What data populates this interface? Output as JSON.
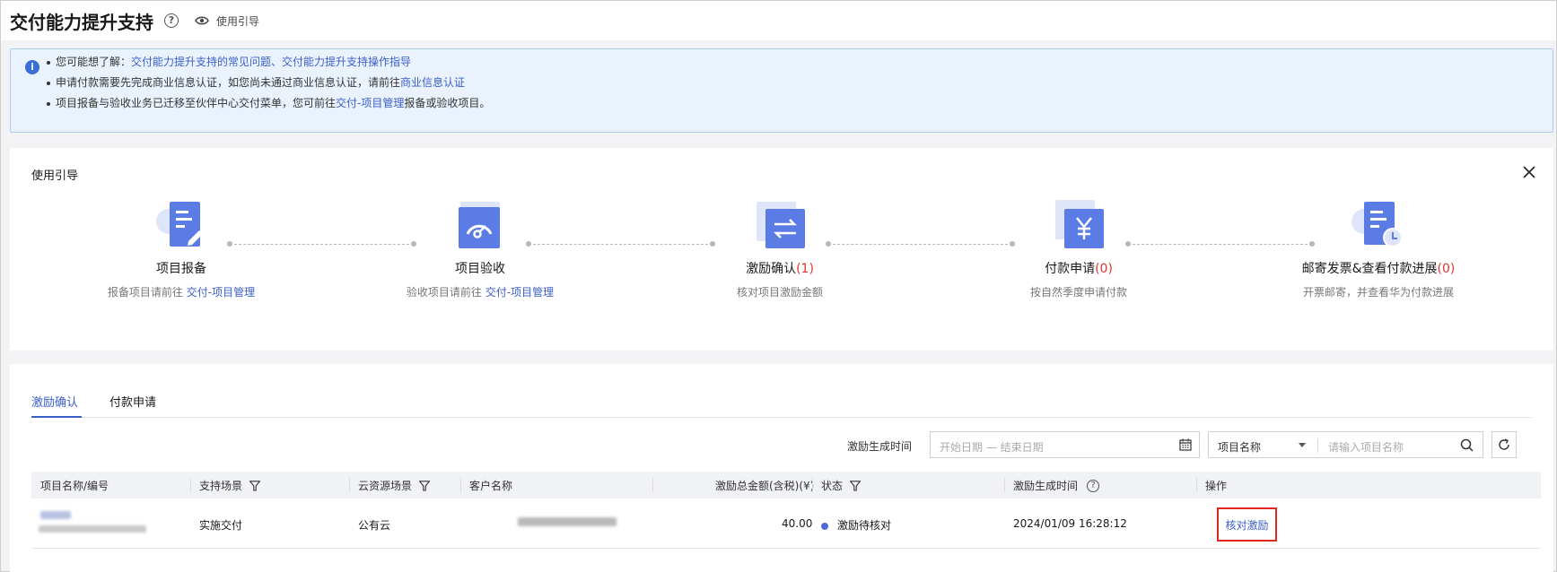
{
  "colors": {
    "accent": "#3a5ec8",
    "count_red": "#e0362f",
    "highlight_box": "#e0261f",
    "banner_bg": "#eaf3fd",
    "icon_blue": "#5b7ce5"
  },
  "header": {
    "title": "交付能力提升支持",
    "help_icon": "question-circle-icon",
    "guide_link": "使用引导"
  },
  "banner": {
    "line1_prefix": "您可能想了解：",
    "line1_link1": "交付能力提升支持的常见问题",
    "line1_sep": "、",
    "line1_link2": "交付能力提升支持操作指导",
    "line2_prefix": "申请付款需要先完成商业信息认证，如您尚未通过商业信息认证，请前往",
    "line2_link": "商业信息认证",
    "line3_prefix": "项目报备与验收业务已迁移至伙伴中心交付菜单，您可前往",
    "line3_link": "交付-项目管理",
    "line3_suffix": "报备或验收项目。"
  },
  "guide": {
    "title": "使用引导",
    "steps": [
      {
        "name": "项目报备",
        "count": "",
        "desc_prefix": "报备项目请前往 ",
        "desc_link": "交付-项目管理",
        "icon": "document-edit-icon"
      },
      {
        "name": "项目验收",
        "count": "",
        "desc_prefix": "验收项目请前往 ",
        "desc_link": "交付-项目管理",
        "icon": "gauge-icon"
      },
      {
        "name": "激励确认",
        "count": "(1)",
        "desc_prefix": "核对项目激励金额",
        "desc_link": "",
        "icon": "exchange-arrows-icon"
      },
      {
        "name": "付款申请",
        "count": "(0)",
        "desc_prefix": "按自然季度申请付款",
        "desc_link": "",
        "icon": "yen-icon"
      },
      {
        "name": "邮寄发票&查看付款进展",
        "count": "(0)",
        "desc_prefix": "开票邮寄，并查看华为付款进展",
        "desc_link": "",
        "icon": "document-clock-icon"
      }
    ]
  },
  "tabs": [
    {
      "label": "激励确认",
      "active": true
    },
    {
      "label": "付款申请",
      "active": false
    }
  ],
  "filters": {
    "date_label": "激励生成时间",
    "date_placeholder": "开始日期 — 结束日期",
    "select_value": "项目名称",
    "search_placeholder": "请输入项目名称"
  },
  "table": {
    "columns": [
      "项目名称/编号",
      "支持场景",
      "云资源场景",
      "客户名称",
      "激励总金额(含税)(¥)",
      "状态",
      "激励生成时间",
      "操作"
    ],
    "rows": [
      {
        "scenario": "实施交付",
        "cloud": "公有云",
        "amount": "40.00",
        "status": "激励待核对",
        "time": "2024/01/09 16:28:12",
        "action": "核对激励"
      }
    ]
  }
}
